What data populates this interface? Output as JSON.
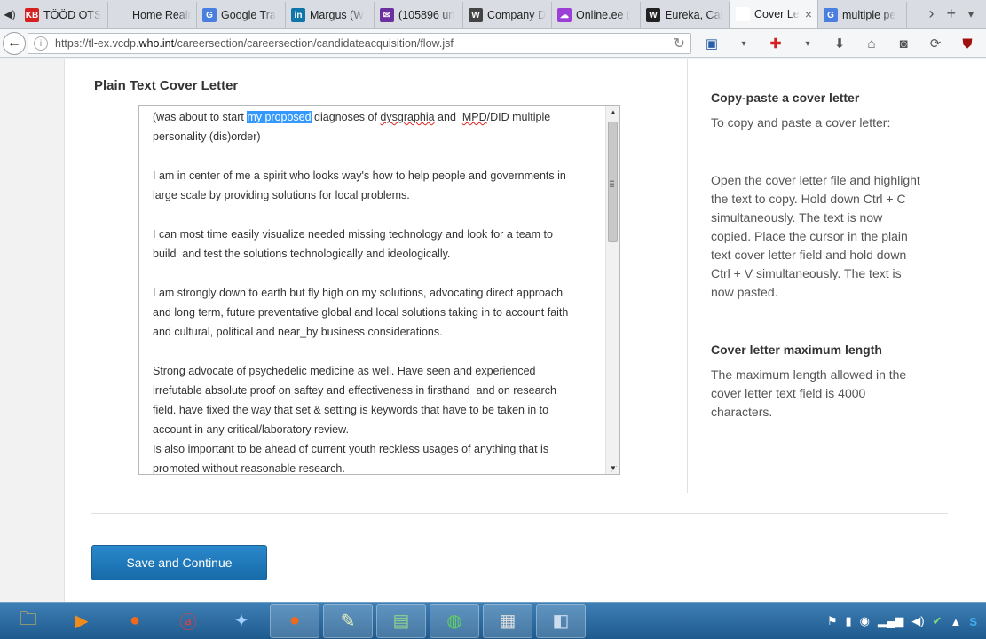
{
  "tabs": [
    {
      "title": "TÖÖD OTS",
      "favicon": "KB",
      "color": "#d61f1f"
    },
    {
      "title": "Home Realm D",
      "favicon": "",
      "color": "#d9dde3"
    },
    {
      "title": "Google Tra",
      "favicon": "G",
      "color": "#4a7fe0"
    },
    {
      "title": "Margus (W",
      "favicon": "in",
      "color": "#0e76a8"
    },
    {
      "title": "(105896 un",
      "favicon": "✉",
      "color": "#6b2fa0"
    },
    {
      "title": "Company D",
      "favicon": "W",
      "color": "#444444"
    },
    {
      "title": "Online.ee (",
      "favicon": "☁",
      "color": "#9b3fd6"
    },
    {
      "title": "Eureka, Cal",
      "favicon": "W",
      "color": "#222222"
    },
    {
      "title": "Cover Le",
      "favicon": "",
      "color": "#ffffff"
    },
    {
      "title": "multiple pe",
      "favicon": "G",
      "color": "#4a7fe0"
    }
  ],
  "url": {
    "prefix": "https://tl-ex.vcdp.",
    "host": "who.int",
    "path": "/careersection/careersection/candidateacquisition/flow.jsf"
  },
  "page": {
    "section_title": "Plain Text Cover Letter",
    "cover_letter": {
      "line1_before": "(was about to start ",
      "selected": "my proposed",
      "line1_mid": " diagnoses of ",
      "misspelled1": "dysgraphia",
      "line1_mid2": " and  ",
      "misspelled2": "MPD",
      "line1_after": "/DID multiple\npersonality (dis)order)\n\nI am in center of me a spirit who looks way's how to help people and governments in\nlarge scale by providing solutions for local problems.\n\nI can most time easily visualize needed missing technology and look for a team to\nbuild  and test the solutions technologically and ideologically.\n\nI am strongly down to earth but fly high on my solutions, advocating direct approach\nand long term, future preventative global and local solutions taking in to account faith\nand cultural, political and near_by business considerations.\n\nStrong advocate of psychedelic medicine as well. Have seen and experienced\nirrefutable absolute proof on saftey and effectiveness in firsthand  and on research\nfield. have fixed the way that set & setting is keywords that have to be taken in to\naccount in any critical/laboratory review.\nIs also important to be ahead of current youth reckless usages of anything that is\npromoted without reasonable research."
    },
    "help1_title": "Copy-paste a cover letter",
    "help1_intro": "To copy and paste a cover letter:",
    "help1_body": "Open the cover letter file and highlight the text to copy. Hold down Ctrl + C simultaneously. The text is now copied. Place the cursor in the plain text cover letter field and hold down Ctrl + V simultaneously. The text is now pasted.",
    "help2_title": "Cover letter maximum length",
    "help2_body": "The maximum length allowed in the cover letter text field is 4000 characters.",
    "save_label": "Save and Continue"
  }
}
